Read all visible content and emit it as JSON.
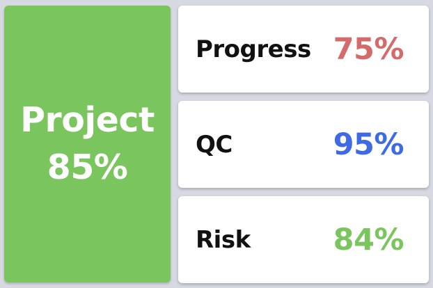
{
  "project": {
    "label": "Project",
    "value": "85%",
    "color": "#7ac55e"
  },
  "metrics": [
    {
      "label": "Progress",
      "value": "75%",
      "color": "#d46a6a"
    },
    {
      "label": "QC",
      "value": "95%",
      "color": "#3f6ae6"
    },
    {
      "label": "Risk",
      "value": "84%",
      "color": "#7ac55e"
    }
  ]
}
